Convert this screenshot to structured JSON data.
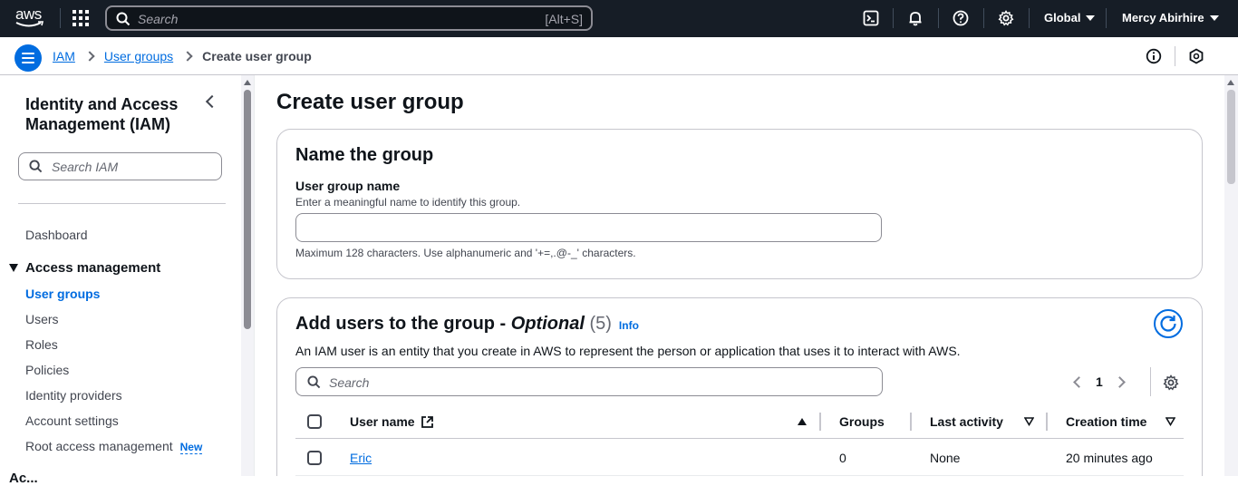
{
  "topnav": {
    "logo_text": "aws",
    "search_placeholder": "Search",
    "search_shortcut": "[Alt+S]",
    "region": "Global",
    "user": "Mercy Abirhire"
  },
  "breadcrumb": {
    "items": [
      "IAM",
      "User groups"
    ],
    "current": "Create user group"
  },
  "sidebar": {
    "title": "Identity and Access Management (IAM)",
    "search_placeholder": "Search IAM",
    "dashboard": "Dashboard",
    "section": "Access management",
    "items": [
      "User groups",
      "Users",
      "Roles",
      "Policies",
      "Identity providers",
      "Account settings",
      "Root access management"
    ],
    "active_item": "User groups",
    "new_badge": "New",
    "next_section_partial": "Ac..."
  },
  "main": {
    "page_title": "Create user group",
    "name_card": {
      "heading": "Name the group",
      "label": "User group name",
      "description": "Enter a meaningful name to identify this group.",
      "value": "",
      "hint": "Maximum 128 characters. Use alphanumeric and '+=,.@-_' characters."
    },
    "users_card": {
      "heading_main": "Add users to the group - ",
      "heading_optional": "Optional",
      "count": "(5)",
      "info": "Info",
      "description": "An IAM user is an entity that you create in AWS to represent the person or application that uses it to interact with AWS.",
      "search_placeholder": "Search",
      "page": "1",
      "columns": [
        "User name",
        "Groups",
        "Last activity",
        "Creation time"
      ],
      "rows": [
        {
          "user_name": "Eric",
          "groups": "0",
          "last_activity": "None",
          "creation_time": "20 minutes ago"
        }
      ]
    }
  },
  "colors": {
    "topnav_bg": "#161d26",
    "accent": "#006ce0",
    "border": "#c6c6cd"
  }
}
